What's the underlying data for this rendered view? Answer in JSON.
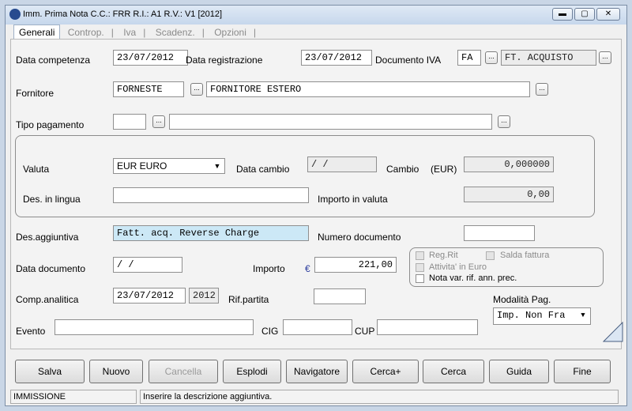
{
  "window": {
    "title": "Imm. Prima Nota C.C.: FRR  R.I.: A1  R.V.: V1  [2012]",
    "minimize_label": "▬",
    "maximize_label": "▢",
    "close_label": "✕"
  },
  "tabs": [
    "Generali",
    "Controp.",
    "Iva",
    "Scadenz.",
    "Opzioni"
  ],
  "form": {
    "data_competenza_label": "Data competenza",
    "data_competenza": "23/07/2012",
    "data_registrazione_label": "Data registrazione",
    "data_registrazione": "23/07/2012",
    "documento_iva_label": "Documento IVA",
    "documento_iva_code": "FA",
    "documento_iva_desc": "FT. ACQUISTO",
    "fornitore_label": "Fornitore",
    "fornitore_code": "FORNESTE",
    "fornitore_desc": "FORNITORE ESTERO",
    "tipo_pagamento_label": "Tipo pagamento",
    "tipo_pagamento_code": "",
    "tipo_pagamento_desc": "",
    "valuta_label": "Valuta",
    "valuta_value": "EUR EURO",
    "data_cambio_label": "Data cambio",
    "data_cambio": " /  /",
    "cambio_label": "Cambio",
    "cambio_unit": "(EUR)",
    "cambio_value": "0,000000",
    "des_lingua_label": "Des. in lingua",
    "des_lingua": "",
    "importo_valuta_label": "Importo in valuta",
    "importo_valuta": "0,00",
    "des_aggiuntiva_label": "Des.aggiuntiva",
    "des_aggiuntiva": "Fatt. acq. Reverse Charge",
    "numero_documento_label": "Numero documento",
    "numero_documento": "",
    "data_documento_label": "Data documento",
    "data_documento": " /  /",
    "importo_label": "Importo",
    "importo_currency": "€",
    "importo": "221,00",
    "reg_rit_label": "Reg.Rit",
    "salda_fattura_label": "Salda fattura",
    "attivita_euro_label": "Attivita' in Euro",
    "nota_var_label": "Nota var. rif. ann. prec.",
    "comp_analitica_label": "Comp.analitica",
    "comp_analitica": "23/07/2012",
    "comp_year": "2012",
    "rif_partita_label": "Rif.partita",
    "rif_partita": "",
    "modalita_pag_label": "Modalità Pag.",
    "modalita_pag": "Imp. Non Fra",
    "evento_label": "Evento",
    "evento": "",
    "cig_label": "CIG",
    "cig": "",
    "cup_label": "CUP",
    "cup": ""
  },
  "buttons": {
    "salva": "Salva",
    "nuovo": "Nuovo",
    "cancella": "Cancella",
    "esplodi": "Esplodi",
    "navigatore": "Navigatore",
    "cerca_plus": "Cerca+",
    "cerca": "Cerca",
    "guida": "Guida",
    "fine": "Fine"
  },
  "status": {
    "mode": "IMMISSIONE",
    "message": "Inserire la descrizione aggiuntiva."
  },
  "icons": {
    "dots": "..."
  }
}
